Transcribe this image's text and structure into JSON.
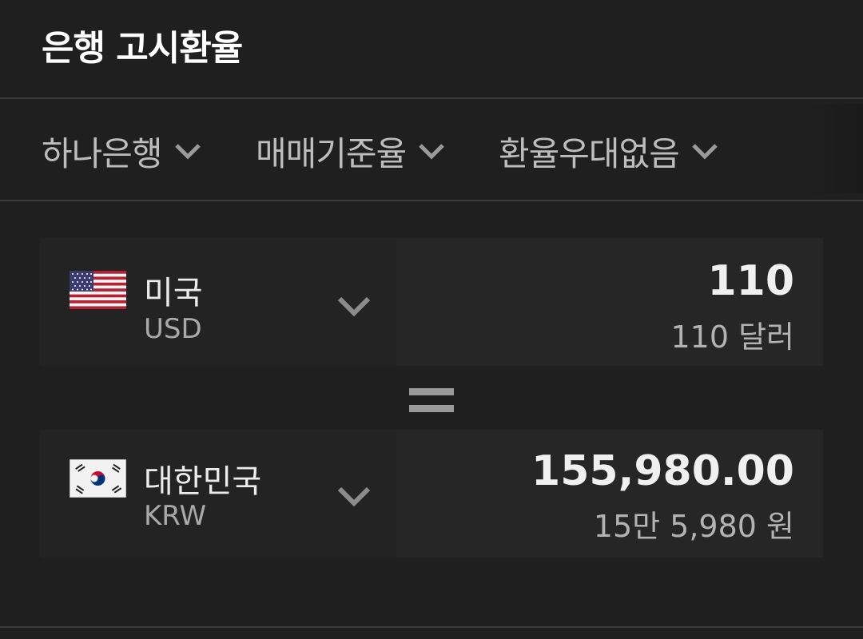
{
  "header": {
    "title": "은행 고시환율"
  },
  "filters": [
    {
      "label": "하나은행"
    },
    {
      "label": "매매기준율"
    },
    {
      "label": "환율우대없음"
    }
  ],
  "converter": {
    "from": {
      "country": "미국",
      "code": "USD",
      "amount": "110",
      "amount_words": "110 달러"
    },
    "to": {
      "country": "대한민국",
      "code": "KRW",
      "amount": "155,980.00",
      "amount_words": "15만 5,980 원"
    }
  },
  "icons": {
    "dropdown": "chevron-down-icon",
    "equals": "equals-icon",
    "from_flag": "us-flag-icon",
    "to_flag": "kr-flag-icon"
  },
  "colors": {
    "background": "#1f1f1f",
    "card": "#232323",
    "amount_panel": "#262626",
    "text_primary": "#f0f0f0",
    "text_secondary": "#a9a9a9"
  }
}
